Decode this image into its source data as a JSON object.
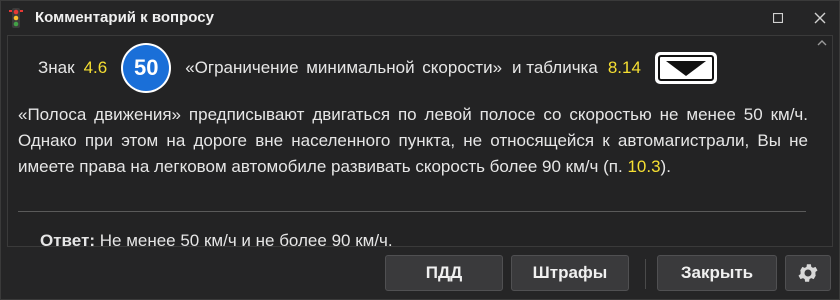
{
  "window": {
    "title": "Комментарий к вопросу",
    "app_icon": "traffic-light-icon",
    "controls": [
      "maximize-icon",
      "close-icon"
    ]
  },
  "comment": {
    "line1": {
      "prefix": "Знак",
      "sign_number": "4.6",
      "sign_value": "50",
      "sign_name": "«Ограничение минимальной скорости»",
      "conjunction": "и табличка",
      "plate_number": "8.14",
      "plate_icon": "arrow-down-icon"
    },
    "paragraph_part1": "«Полоса движения» предписывают двигаться по левой полосе со скоростью не менее 50 км/ч. Однако при этом на дороге вне населенного пункта, не относящейся к автомагистрали, Вы не имеете права на легковом автомобиле развивать скорость более 90 км/ч (п. ",
    "paragraph_ref": "10.3",
    "paragraph_end": ").",
    "answer_label": "Ответ:",
    "answer_text": "Не менее 50 км/ч и не более 90 км/ч."
  },
  "buttons": {
    "pdd": "ПДД",
    "fines": "Штрафы",
    "close": "Закрыть",
    "settings_icon": "gear-icon"
  },
  "colors": {
    "highlight": "#f6df32",
    "sign_blue": "#1a6fd8",
    "background": "#252526"
  }
}
